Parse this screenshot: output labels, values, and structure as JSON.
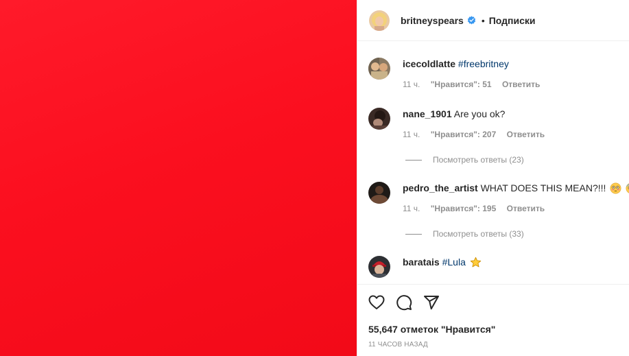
{
  "post": {
    "author": "britneyspears",
    "separator": "•",
    "follow_label": "Подписки",
    "media_color": "#ff1423"
  },
  "comments": [
    {
      "user": "icecoldlatte",
      "text": "#freebritney",
      "time": "11 ч.",
      "likes": "\"Нравится\": 51",
      "reply_label": "Ответить"
    },
    {
      "user": "nane_1901",
      "text": "Are you ok?",
      "time": "11 ч.",
      "likes": "\"Нравится\": 207",
      "reply_label": "Ответить",
      "view_replies": "Посмотреть ответы (23)"
    },
    {
      "user": "pedro_the_artist",
      "text": "WHAT DOES THIS MEAN?!!!",
      "emojis": [
        "flushed-face-icon",
        "fearful-face-icon"
      ],
      "time": "11 ч.",
      "likes": "\"Нравится\": 195",
      "reply_label": "Ответить",
      "view_replies": "Посмотреть ответы (33)"
    },
    {
      "user": "baratais",
      "text": "#Lula",
      "emojis": [
        "star-icon"
      ]
    }
  ],
  "actions": {
    "icons": [
      "heart-icon",
      "comment-icon",
      "share-icon"
    ],
    "likes_text": "55,647 отметок \"Нравится\"",
    "timestamp": "11 ЧАСОВ НАЗАД"
  }
}
